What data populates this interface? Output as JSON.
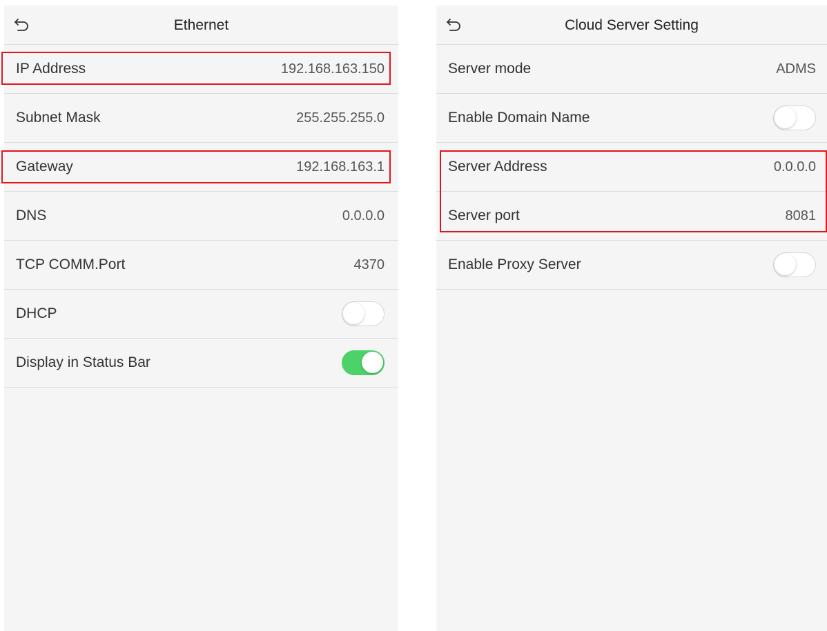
{
  "ethernet": {
    "title": "Ethernet",
    "rows": [
      {
        "label": "IP Address",
        "value": "192.168.163.150"
      },
      {
        "label": "Subnet Mask",
        "value": "255.255.255.0"
      },
      {
        "label": "Gateway",
        "value": "192.168.163.1"
      },
      {
        "label": "DNS",
        "value": "0.0.0.0"
      },
      {
        "label": "TCP COMM.Port",
        "value": "4370"
      },
      {
        "label": "DHCP",
        "toggle": "off"
      },
      {
        "label": "Display in Status Bar",
        "toggle": "on"
      }
    ]
  },
  "cloud": {
    "title": "Cloud Server Setting",
    "rows": [
      {
        "label": "Server mode",
        "value": "ADMS"
      },
      {
        "label": "Enable Domain Name",
        "toggle": "off"
      },
      {
        "label": "Server Address",
        "value": "0.0.0.0"
      },
      {
        "label": "Server port",
        "value": "8081"
      },
      {
        "label": "Enable Proxy Server",
        "toggle": "off"
      }
    ]
  },
  "colors": {
    "highlight": "#e0151b",
    "toggle_on": "#4cd268",
    "background": "#f5f5f5"
  },
  "icons": {
    "back": "back-arrow-icon"
  }
}
